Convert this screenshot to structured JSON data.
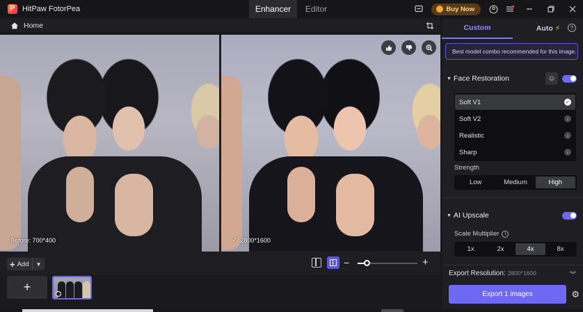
{
  "app": {
    "title": "HitPaw FotorPea"
  },
  "top_tabs": [
    {
      "label": "Enhancer",
      "active": true
    },
    {
      "label": "Editor",
      "active": false
    }
  ],
  "titlebar": {
    "buy_label": "Buy Now"
  },
  "subbar": {
    "home_label": "Home"
  },
  "preview": {
    "before_label": "Before: 700*400",
    "after_label": "2800*1600"
  },
  "toolbar": {
    "add_label": "Add",
    "zoom_level": 0.15
  },
  "panel": {
    "tabs": [
      {
        "label": "Custom",
        "active": true
      },
      {
        "label": "Auto",
        "active": false
      }
    ],
    "info_text": "Best model combo recommended for this image.",
    "face_restoration": {
      "label": "Face Restoration",
      "enabled": true,
      "models": [
        {
          "label": "Soft V1",
          "selected": true
        },
        {
          "label": "Soft V2",
          "selected": false
        },
        {
          "label": "Realistic",
          "selected": false
        },
        {
          "label": "Sharp",
          "selected": false
        }
      ],
      "strength_label": "Strength",
      "strength_options": [
        {
          "label": "Low",
          "active": false
        },
        {
          "label": "Medium",
          "active": false
        },
        {
          "label": "High",
          "active": true
        }
      ]
    },
    "ai_upscale": {
      "label": "AI Upscale",
      "enabled": true,
      "scale_label": "Scale Multiplier",
      "scale_options": [
        {
          "label": "1x",
          "active": false
        },
        {
          "label": "2x",
          "active": false
        },
        {
          "label": "4x",
          "active": true
        },
        {
          "label": "8x",
          "active": false
        }
      ]
    },
    "export_resolution_label": "Export Resolution:",
    "export_resolution_value": "2800*1600",
    "export_button_label": "Export 1 images"
  },
  "colors": {
    "accent": "#6d69f2",
    "buy_bg": "#5a3a16",
    "buy_text": "#ffd38a"
  }
}
